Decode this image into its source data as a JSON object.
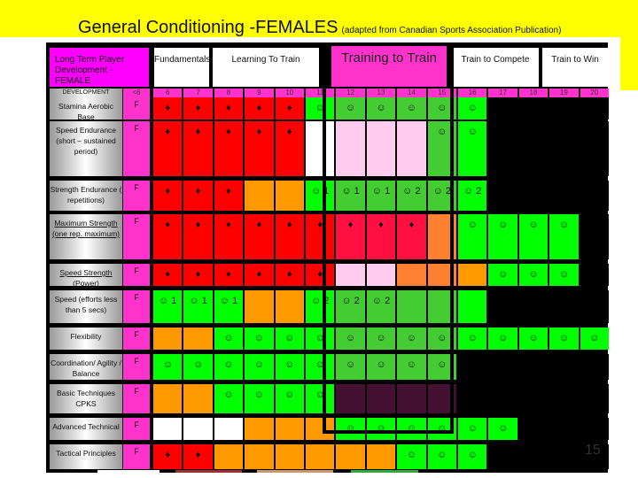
{
  "title": "General Conditioning -FEMALES",
  "subtitle": "(adapted from Canadian Sports Association Publication)",
  "stages": [
    {
      "label": "Long Term Player Development - FEMALE"
    },
    {
      "label": "Fundamentals"
    },
    {
      "label": "Learning To Train"
    },
    {
      "label": "Training to Train"
    },
    {
      "label": "Train to Compete"
    },
    {
      "label": "Train to Win"
    }
  ],
  "age_row_label": "DEVELOPMENT",
  "ages": [
    "<6",
    "6",
    "7",
    "8",
    "9",
    "10",
    "11",
    "12",
    "13",
    "14",
    "15",
    "16",
    "17",
    "18",
    "19",
    "20"
  ],
  "colors": {
    "red": "#ff0000",
    "crimson": "#ff1040",
    "orange": "#ff9900",
    "dark_orange": "#ff8030",
    "green": "#00ff00",
    "mid_green": "#44cc33",
    "pink": "#ffccf0",
    "white": "#ffffff",
    "plum": "#441133",
    "magenta": "#ff33cc",
    "black": "#000000"
  },
  "legend": {
    "diamond": "♦",
    "smiley": "☺"
  },
  "rows": [
    {
      "label": "Stamina Aerobic Base",
      "first": "F",
      "cells": [
        [
          "red",
          "♦"
        ],
        [
          "red",
          "♦"
        ],
        [
          "red",
          "♦"
        ],
        [
          "red",
          "♦"
        ],
        [
          "red",
          "♦"
        ],
        [
          "green",
          "☺"
        ],
        [
          "mid_green",
          "☺"
        ],
        [
          "mid_green",
          "☺"
        ],
        [
          "mid_green",
          "☺"
        ],
        [
          "mid_green",
          "☺"
        ],
        [
          "green",
          "☺"
        ],
        [
          "black",
          ""
        ],
        [
          "black",
          ""
        ],
        [
          "black",
          ""
        ],
        [
          "black",
          ""
        ]
      ]
    },
    {
      "label": "Speed Endurance (short – sustained period)",
      "first": "F",
      "cells": [
        [
          "red",
          "♦"
        ],
        [
          "red",
          "♦"
        ],
        [
          "red",
          "♦"
        ],
        [
          "red",
          "♦"
        ],
        [
          "red",
          "♦"
        ],
        [
          "white",
          ""
        ],
        [
          "pink",
          ""
        ],
        [
          "pink",
          ""
        ],
        [
          "pink",
          ""
        ],
        [
          "mid_green",
          "☺"
        ],
        [
          "green",
          "☺"
        ],
        [
          "black",
          ""
        ],
        [
          "black",
          ""
        ],
        [
          "black",
          ""
        ],
        [
          "black",
          ""
        ]
      ]
    },
    {
      "label": "Strength Endurance ( repetitions)",
      "first": "F",
      "cells": [
        [
          "red",
          "♦"
        ],
        [
          "red",
          "♦"
        ],
        [
          "red",
          "♦"
        ],
        [
          "orange",
          ""
        ],
        [
          "orange",
          ""
        ],
        [
          "green",
          "☺ 1"
        ],
        [
          "mid_green",
          "☺ 1"
        ],
        [
          "mid_green",
          "☺ 1"
        ],
        [
          "mid_green",
          "☺ 2"
        ],
        [
          "mid_green",
          "☺ 2"
        ],
        [
          "green",
          "☺ 2"
        ],
        [
          "black",
          ""
        ],
        [
          "black",
          ""
        ],
        [
          "black",
          ""
        ],
        [
          "black",
          ""
        ]
      ]
    },
    {
      "label": "Maximum Strength (one rep. maximum)",
      "first": "F",
      "underline": true,
      "cells": [
        [
          "red",
          "♦"
        ],
        [
          "red",
          "♦"
        ],
        [
          "red",
          "♦"
        ],
        [
          "red",
          "♦"
        ],
        [
          "red",
          "♦"
        ],
        [
          "red",
          "♦"
        ],
        [
          "crimson",
          "♦"
        ],
        [
          "crimson",
          "♦"
        ],
        [
          "crimson",
          "♦"
        ],
        [
          "dark_orange",
          ""
        ],
        [
          "green",
          "☺"
        ],
        [
          "green",
          "☺"
        ],
        [
          "green",
          "☺"
        ],
        [
          "green",
          "☺"
        ],
        [
          "black",
          ""
        ]
      ]
    },
    {
      "label": "Speed Strength (Power)",
      "first": "F",
      "underline": true,
      "cells": [
        [
          "red",
          "♦"
        ],
        [
          "red",
          "♦"
        ],
        [
          "red",
          "♦"
        ],
        [
          "red",
          "♦"
        ],
        [
          "red",
          "♦"
        ],
        [
          "red",
          "♦"
        ],
        [
          "pink",
          ""
        ],
        [
          "pink",
          ""
        ],
        [
          "dark_orange",
          ""
        ],
        [
          "dark_orange",
          ""
        ],
        [
          "orange",
          ""
        ],
        [
          "green",
          "☺"
        ],
        [
          "green",
          "☺"
        ],
        [
          "green",
          "☺"
        ],
        [
          "black",
          ""
        ]
      ]
    },
    {
      "label": "Speed (efforts less than 5 secs)",
      "first": "F",
      "cells": [
        [
          "green",
          "☺ 1"
        ],
        [
          "green",
          "☺ 1"
        ],
        [
          "green",
          "☺ 1"
        ],
        [
          "orange",
          ""
        ],
        [
          "orange",
          ""
        ],
        [
          "green",
          "☺ 2"
        ],
        [
          "mid_green",
          "☺ 2"
        ],
        [
          "mid_green",
          "☺ 2"
        ],
        [
          "mid_green",
          ""
        ],
        [
          "mid_green",
          ""
        ],
        [
          "green",
          ""
        ],
        [
          "black",
          ""
        ],
        [
          "black",
          ""
        ],
        [
          "black",
          ""
        ],
        [
          "black",
          ""
        ]
      ]
    },
    {
      "label": "Flexibility",
      "first": "F",
      "cells": [
        [
          "orange",
          ""
        ],
        [
          "orange",
          ""
        ],
        [
          "green",
          "☺"
        ],
        [
          "green",
          "☺"
        ],
        [
          "green",
          "☺"
        ],
        [
          "green",
          "☺"
        ],
        [
          "mid_green",
          "☺"
        ],
        [
          "mid_green",
          "☺"
        ],
        [
          "mid_green",
          "☺"
        ],
        [
          "mid_green",
          "☺"
        ],
        [
          "green",
          "☺"
        ],
        [
          "green",
          "☺"
        ],
        [
          "green",
          "☺"
        ],
        [
          "green",
          "☺"
        ],
        [
          "green",
          "☺"
        ]
      ]
    },
    {
      "label": "Coordination/ Agility / Balance",
      "first": "F",
      "cells": [
        [
          "green",
          "☺"
        ],
        [
          "green",
          "☺"
        ],
        [
          "green",
          "☺"
        ],
        [
          "green",
          "☺"
        ],
        [
          "green",
          "☺"
        ],
        [
          "green",
          "☺"
        ],
        [
          "mid_green",
          "☺"
        ],
        [
          "mid_green",
          "☺"
        ],
        [
          "mid_green",
          "☺"
        ],
        [
          "mid_green",
          "☺"
        ],
        [
          "black",
          ""
        ],
        [
          "black",
          ""
        ],
        [
          "black",
          ""
        ],
        [
          "black",
          ""
        ],
        [
          "black",
          ""
        ]
      ]
    },
    {
      "label": "Basic Techniques CPKS",
      "first": "F",
      "cells": [
        [
          "orange",
          ""
        ],
        [
          "orange",
          ""
        ],
        [
          "green",
          "☺"
        ],
        [
          "green",
          "☺"
        ],
        [
          "green",
          "☺"
        ],
        [
          "green",
          "☺"
        ],
        [
          "plum",
          ""
        ],
        [
          "plum",
          ""
        ],
        [
          "plum",
          ""
        ],
        [
          "plum",
          ""
        ],
        [
          "black",
          ""
        ],
        [
          "black",
          ""
        ],
        [
          "black",
          ""
        ],
        [
          "black",
          ""
        ],
        [
          "black",
          ""
        ]
      ]
    },
    {
      "label": "Advanced Technical",
      "first": "F",
      "cells": [
        [
          "white",
          ""
        ],
        [
          "white",
          ""
        ],
        [
          "white",
          ""
        ],
        [
          "orange",
          ""
        ],
        [
          "orange",
          ""
        ],
        [
          "orange",
          ""
        ],
        [
          "green",
          "☺"
        ],
        [
          "green",
          "☺"
        ],
        [
          "green",
          "☺"
        ],
        [
          "green",
          "☺"
        ],
        [
          "green",
          "☺"
        ],
        [
          "green",
          "☺"
        ],
        [
          "black",
          ""
        ],
        [
          "black",
          ""
        ],
        [
          "black",
          ""
        ]
      ]
    },
    {
      "label": "Tactical Principles",
      "first": "F",
      "cells": [
        [
          "red",
          "♦"
        ],
        [
          "red",
          "♦"
        ],
        [
          "orange",
          ""
        ],
        [
          "orange",
          ""
        ],
        [
          "orange",
          ""
        ],
        [
          "orange",
          ""
        ],
        [
          "orange",
          ""
        ],
        [
          "orange",
          ""
        ],
        [
          "green",
          "☺"
        ],
        [
          "green",
          "☺"
        ],
        [
          "green",
          "☺"
        ],
        [
          "black",
          ""
        ],
        [
          "black",
          ""
        ],
        [
          "black",
          ""
        ],
        [
          "black",
          ""
        ]
      ]
    }
  ],
  "page_number": "15"
}
